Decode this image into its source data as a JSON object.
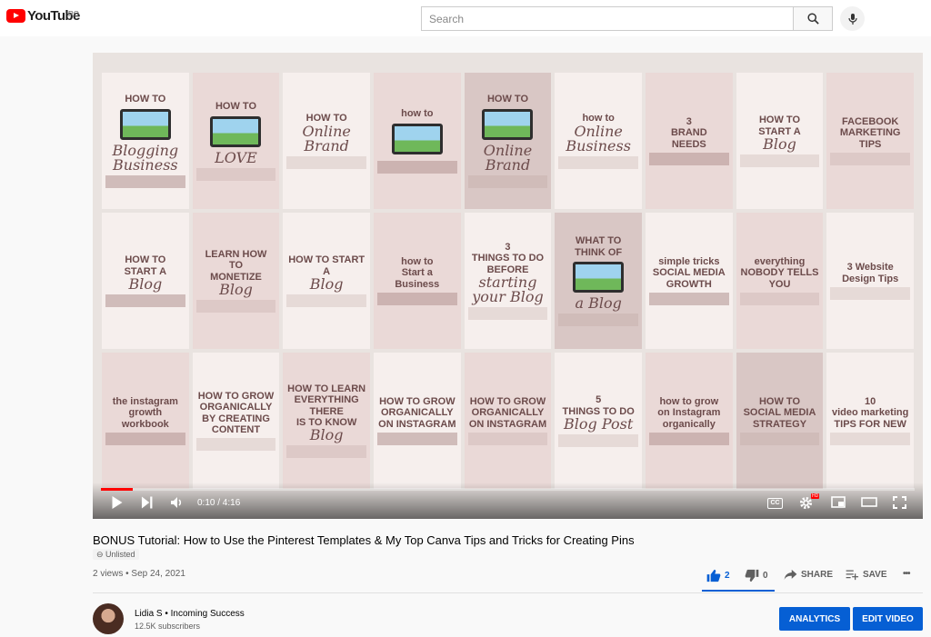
{
  "header": {
    "logo_text": "YouTube",
    "region": "RO",
    "search_placeholder": "Search"
  },
  "player": {
    "current_time": "0:10",
    "duration": "4:16",
    "time_display": "0:10 / 4:16",
    "progress_percent": 3.9,
    "cc_label": "CC",
    "hd_badge": "HD",
    "pins": [
      {
        "lines": [
          "HOW TO"
        ],
        "script": "Blogging Business",
        "laptop": true,
        "style": ""
      },
      {
        "lines": [
          "HOW TO"
        ],
        "script": "LOVE",
        "laptop": true,
        "style": "alt"
      },
      {
        "lines": [
          "HOW TO"
        ],
        "script": "Online Brand",
        "laptop": false,
        "style": ""
      },
      {
        "lines": [
          "how to"
        ],
        "script": "",
        "laptop": true,
        "style": "alt"
      },
      {
        "lines": [
          "HOW TO"
        ],
        "script": "Online Brand",
        "laptop": true,
        "style": "dark"
      },
      {
        "lines": [
          "how to"
        ],
        "script": "Online Business",
        "laptop": false,
        "style": ""
      },
      {
        "lines": [
          "3",
          "BRAND",
          "NEEDS"
        ],
        "script": "",
        "laptop": false,
        "style": "alt"
      },
      {
        "lines": [
          "HOW TO",
          "START A"
        ],
        "script": "Blog",
        "laptop": false,
        "style": ""
      },
      {
        "lines": [
          "FACEBOOK",
          "MARKETING TIPS"
        ],
        "script": "",
        "laptop": false,
        "style": "alt"
      },
      {
        "lines": [
          "HOW TO",
          "START A"
        ],
        "script": "Blog",
        "laptop": false,
        "style": ""
      },
      {
        "lines": [
          "LEARN HOW",
          "TO",
          "MONETIZE"
        ],
        "script": "Blog",
        "laptop": false,
        "style": "alt"
      },
      {
        "lines": [
          "HOW TO START A"
        ],
        "script": "Blog",
        "laptop": false,
        "style": ""
      },
      {
        "lines": [
          "how to",
          "Start a",
          "Business"
        ],
        "script": "",
        "laptop": false,
        "style": "alt"
      },
      {
        "lines": [
          "3",
          "THINGS TO DO",
          "BEFORE"
        ],
        "script": "starting your Blog",
        "laptop": false,
        "style": ""
      },
      {
        "lines": [
          "WHAT TO",
          "THINK OF"
        ],
        "script": "a Blog",
        "laptop": true,
        "style": "dark"
      },
      {
        "lines": [
          "simple tricks",
          "SOCIAL MEDIA",
          "GROWTH"
        ],
        "script": "",
        "laptop": false,
        "style": ""
      },
      {
        "lines": [
          "everything",
          "NOBODY TELLS YOU"
        ],
        "script": "",
        "laptop": false,
        "style": "alt"
      },
      {
        "lines": [
          "3 Website",
          "Design Tips"
        ],
        "script": "",
        "laptop": false,
        "style": ""
      },
      {
        "lines": [
          "the instagram",
          "growth workbook"
        ],
        "script": "",
        "laptop": false,
        "style": "alt"
      },
      {
        "lines": [
          "HOW TO GROW",
          "ORGANICALLY",
          "BY CREATING",
          "CONTENT"
        ],
        "script": "",
        "laptop": false,
        "style": ""
      },
      {
        "lines": [
          "HOW TO LEARN",
          "EVERYTHING THERE",
          "IS TO KNOW"
        ],
        "script": "Blog",
        "laptop": false,
        "style": "alt"
      },
      {
        "lines": [
          "HOW TO GROW",
          "ORGANICALLY",
          "ON INSTAGRAM"
        ],
        "script": "",
        "laptop": false,
        "style": ""
      },
      {
        "lines": [
          "HOW TO GROW",
          "ORGANICALLY",
          "ON INSTAGRAM"
        ],
        "script": "",
        "laptop": false,
        "style": "alt"
      },
      {
        "lines": [
          "5",
          "THINGS TO DO"
        ],
        "script": "Blog Post",
        "laptop": false,
        "style": ""
      },
      {
        "lines": [
          "how to grow",
          "on Instagram",
          "organically"
        ],
        "script": "",
        "laptop": false,
        "style": "alt"
      },
      {
        "lines": [
          "HOW TO",
          "SOCIAL MEDIA",
          "STRATEGY"
        ],
        "script": "",
        "laptop": false,
        "style": "dark"
      },
      {
        "lines": [
          "10",
          "video marketing",
          "TIPS FOR NEW"
        ],
        "script": "",
        "laptop": false,
        "style": ""
      }
    ]
  },
  "video": {
    "title": "BONUS Tutorial: How to Use the Pinterest Templates & My Top Canva Tips and Tricks for Creating Pins",
    "visibility": "Unlisted",
    "views_date": "2 views • Sep 24, 2021",
    "likes": "2",
    "dislikes": "0",
    "share_label": "SHARE",
    "save_label": "SAVE",
    "more_label": "•••"
  },
  "channel": {
    "name": "Lidia S • Incoming Success",
    "subscribers": "12.5K subscribers",
    "analytics_label": "ANALYTICS",
    "edit_label": "EDIT VIDEO"
  },
  "colors": {
    "brand_red": "#ff0000",
    "accent_blue": "#065fd4"
  }
}
